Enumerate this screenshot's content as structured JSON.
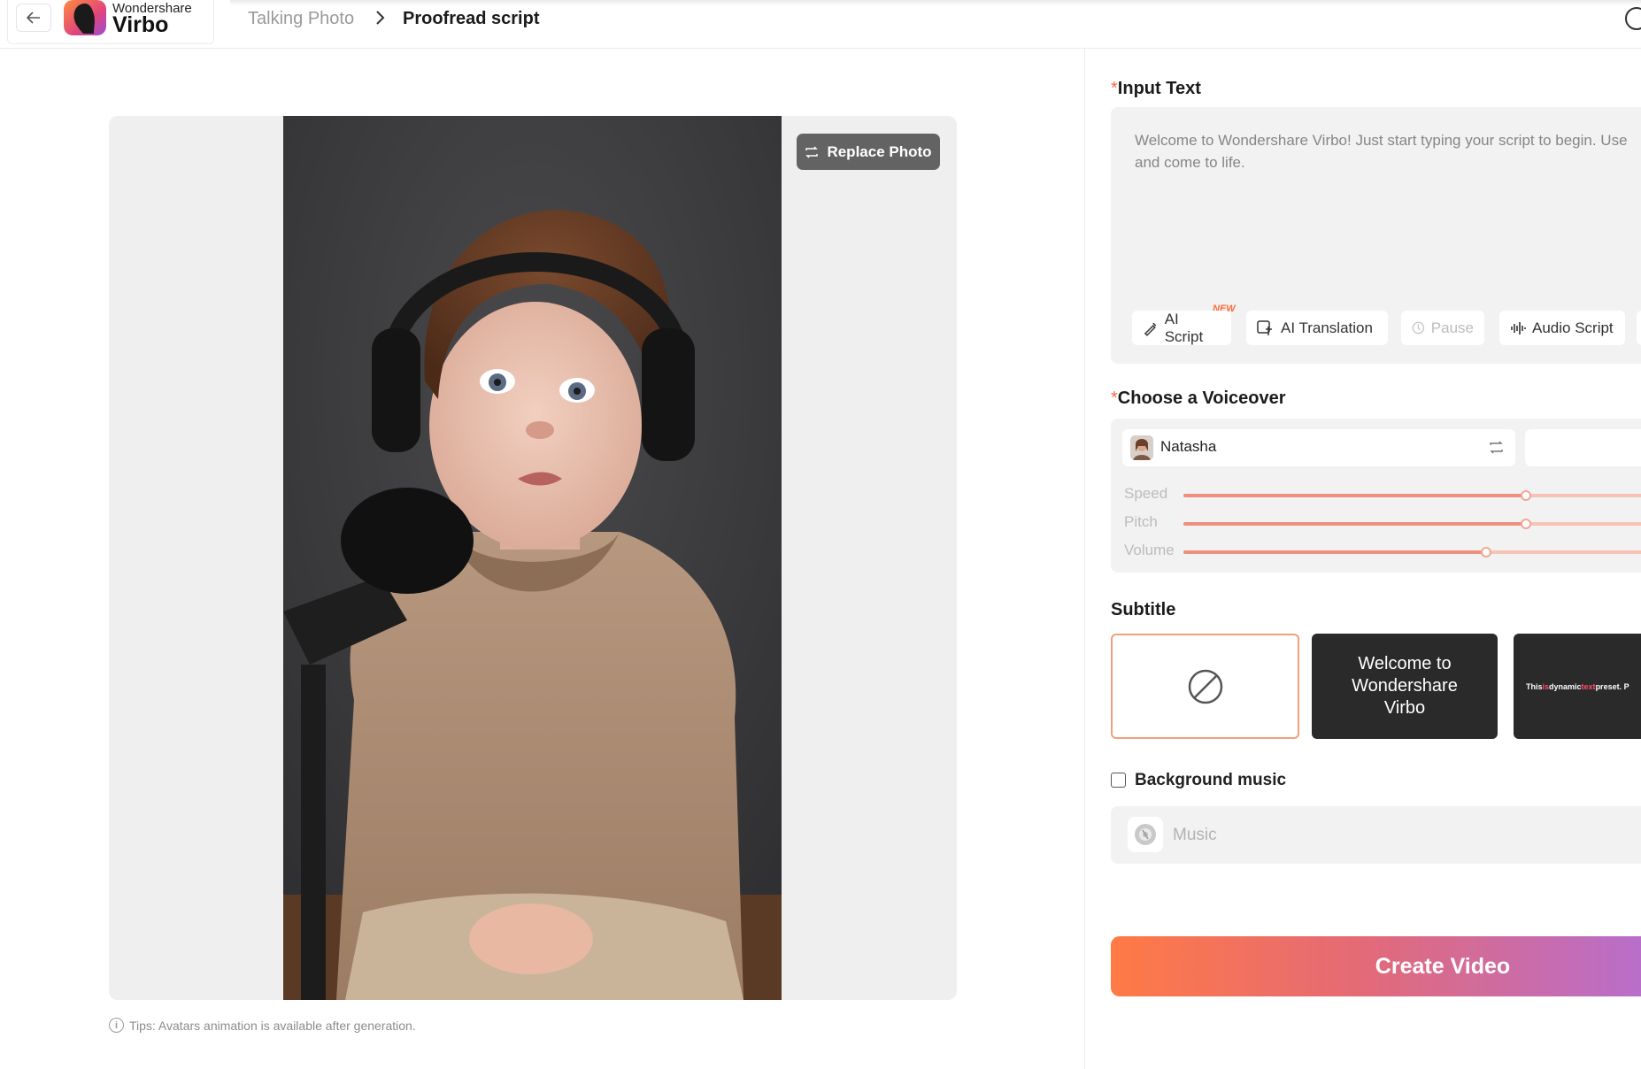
{
  "header": {
    "brand_top": "Wondershare",
    "brand_name": "Virbo",
    "breadcrumb": [
      "Talking Photo",
      "Proofread script"
    ]
  },
  "preview": {
    "replace_photo_label": "Replace Photo",
    "tips": "Tips: Avatars animation is available after generation."
  },
  "input_text": {
    "title": "Input Text",
    "placeholder_line1": "Welcome to Wondershare Virbo! Just start typing your script to begin. Use",
    "placeholder_line2": "and come to life.",
    "tools": [
      {
        "label": "AI Script",
        "icon": "ai-script-icon",
        "badge": "NEW"
      },
      {
        "label": "AI Translation",
        "icon": "translate-icon"
      },
      {
        "label": "Pause",
        "icon": "pause-clock-icon",
        "disabled": true
      },
      {
        "label": "Audio Script",
        "icon": "audio-wave-icon"
      }
    ]
  },
  "voiceover": {
    "title": "Choose a Voiceover",
    "voice_name": "Natasha",
    "sliders": [
      {
        "label": "Speed",
        "value": 0.61
      },
      {
        "label": "Pitch",
        "value": 0.61
      },
      {
        "label": "Volume",
        "value": 0.54
      }
    ]
  },
  "subtitle": {
    "title": "Subtitle",
    "presets": [
      {
        "type": "none",
        "icon": "no-subtitle-icon"
      },
      {
        "text": "Welcome to Wondershare Virbo"
      },
      {
        "text_parts": [
          "This ",
          "is",
          " dynamic ",
          "text",
          " preset. P"
        ]
      }
    ]
  },
  "background_music": {
    "label": "Background music",
    "checked": false,
    "placeholder": "Music"
  },
  "actions": {
    "create_video": "Create Video"
  },
  "colors": {
    "accent": "#f26a4b",
    "slider": "#ef8f7d",
    "create_gradient": [
      "#ff7a45",
      "#e46a76",
      "#b56ed0"
    ]
  }
}
